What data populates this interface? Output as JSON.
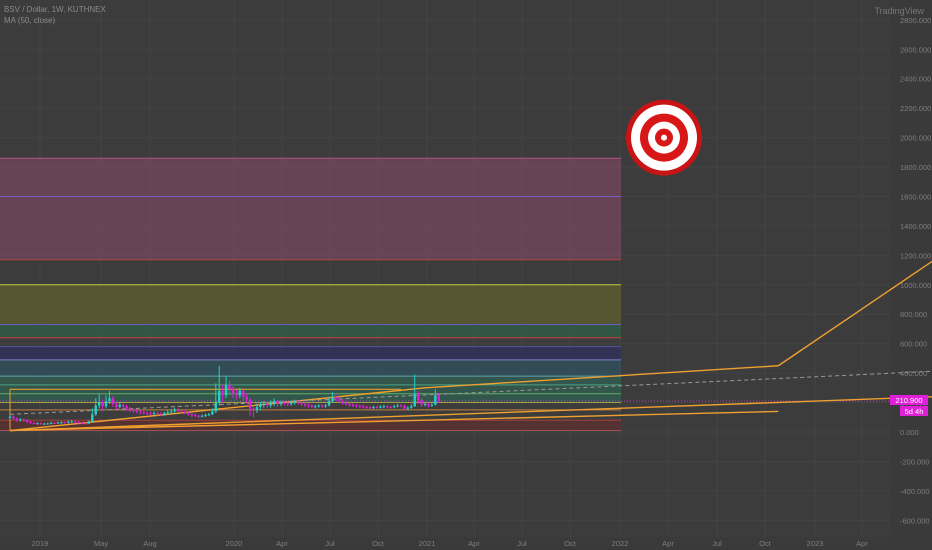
{
  "header": {
    "symbol_line": "BSV / Dollar, 1W, KUTHNEX",
    "indicator_line": "MA (50, close)"
  },
  "logo": "TradingView",
  "chart_data": {
    "type": "candlestick",
    "y_axis": {
      "ticks": [
        2800,
        2600,
        2400,
        2200,
        2000,
        1800,
        1600,
        1400,
        1200,
        1000,
        800,
        600,
        400,
        200,
        0,
        -200,
        -400,
        -600
      ],
      "tick_labels": [
        "2800.000",
        "2600.000",
        "2400.000",
        "2200.000",
        "2000.000",
        "1800.000",
        "1600.000",
        "1400.000",
        "1200.000",
        "1000.000",
        "800.000",
        "600.000",
        "400.000",
        "200.000",
        "0.000",
        "-200.000",
        "-400.000",
        "-600.000"
      ]
    },
    "x_axis": {
      "labels": [
        "2019",
        "May",
        "Aug",
        "2020",
        "Apr",
        "Jul",
        "Oct",
        "2021",
        "Apr",
        "Jul",
        "Oct",
        "2022",
        "Apr",
        "Jul",
        "Oct",
        "2023",
        "Apr"
      ]
    },
    "price_label": "210.900",
    "countdown_label": "5d 4h",
    "target_price": 2000,
    "fib_levels": [
      {
        "price": 1860,
        "color": "#b0508a"
      },
      {
        "price": 1600,
        "color": "#7a5cc0"
      },
      {
        "price": 1170,
        "color": "#b04040"
      },
      {
        "price": 1000,
        "color": "#c8c840"
      },
      {
        "price": 730,
        "color": "#6060c0"
      },
      {
        "price": 640,
        "color": "#c84040"
      },
      {
        "price": 580,
        "color": "#5050a0"
      },
      {
        "price": 490,
        "color": "#8080d0"
      },
      {
        "price": 380,
        "color": "#60a0b0"
      },
      {
        "price": 320,
        "color": "#50a080"
      },
      {
        "price": 260,
        "color": "#60b060"
      },
      {
        "price": 200,
        "color": "#a0a040"
      },
      {
        "price": 150,
        "color": "#c08040"
      },
      {
        "price": 80,
        "color": "#a04040"
      },
      {
        "price": 10,
        "color": "#a05050"
      }
    ],
    "fib_zones": [
      {
        "from": 1170,
        "to": 1860,
        "color": "#8a4a6a"
      },
      {
        "from": 730,
        "to": 1000,
        "color": "#6a6a2a"
      },
      {
        "from": 640,
        "to": 730,
        "color": "#2a6a4a"
      },
      {
        "from": 490,
        "to": 580,
        "color": "#2a2a6a"
      },
      {
        "from": 380,
        "to": 490,
        "color": "#2a5a6a"
      },
      {
        "from": 200,
        "to": 380,
        "color": "#2a6a5a"
      },
      {
        "from": 10,
        "to": 80,
        "color": "#6a2a2a"
      }
    ],
    "candles": [
      {
        "o": 95,
        "c": 105,
        "h": 115,
        "l": 85
      },
      {
        "o": 105,
        "c": 90,
        "h": 112,
        "l": 82
      },
      {
        "o": 90,
        "c": 80,
        "h": 100,
        "l": 70
      },
      {
        "o": 80,
        "c": 85,
        "h": 95,
        "l": 72
      },
      {
        "o": 85,
        "c": 78,
        "h": 92,
        "l": 70
      },
      {
        "o": 78,
        "c": 68,
        "h": 85,
        "l": 60
      },
      {
        "o": 68,
        "c": 62,
        "h": 75,
        "l": 55
      },
      {
        "o": 62,
        "c": 58,
        "h": 68,
        "l": 52
      },
      {
        "o": 58,
        "c": 60,
        "h": 66,
        "l": 50
      },
      {
        "o": 60,
        "c": 55,
        "h": 65,
        "l": 48
      },
      {
        "o": 55,
        "c": 56,
        "h": 62,
        "l": 50
      },
      {
        "o": 56,
        "c": 58,
        "h": 64,
        "l": 50
      },
      {
        "o": 58,
        "c": 62,
        "h": 70,
        "l": 52
      },
      {
        "o": 62,
        "c": 60,
        "h": 68,
        "l": 54
      },
      {
        "o": 60,
        "c": 64,
        "h": 72,
        "l": 56
      },
      {
        "o": 64,
        "c": 66,
        "h": 74,
        "l": 58
      },
      {
        "o": 66,
        "c": 62,
        "h": 72,
        "l": 56
      },
      {
        "o": 62,
        "c": 70,
        "h": 78,
        "l": 58
      },
      {
        "o": 70,
        "c": 72,
        "h": 82,
        "l": 62
      },
      {
        "o": 72,
        "c": 68,
        "h": 80,
        "l": 60
      },
      {
        "o": 68,
        "c": 62,
        "h": 74,
        "l": 55
      },
      {
        "o": 62,
        "c": 60,
        "h": 68,
        "l": 52
      },
      {
        "o": 60,
        "c": 58,
        "h": 66,
        "l": 50
      },
      {
        "o": 58,
        "c": 70,
        "h": 78,
        "l": 54
      },
      {
        "o": 70,
        "c": 120,
        "h": 160,
        "l": 65
      },
      {
        "o": 120,
        "c": 180,
        "h": 230,
        "l": 110
      },
      {
        "o": 180,
        "c": 200,
        "h": 260,
        "l": 160
      },
      {
        "o": 200,
        "c": 175,
        "h": 220,
        "l": 150
      },
      {
        "o": 175,
        "c": 210,
        "h": 250,
        "l": 160
      },
      {
        "o": 210,
        "c": 230,
        "h": 280,
        "l": 190
      },
      {
        "o": 230,
        "c": 190,
        "h": 245,
        "l": 170
      },
      {
        "o": 190,
        "c": 170,
        "h": 205,
        "l": 150
      },
      {
        "o": 170,
        "c": 185,
        "h": 200,
        "l": 160
      },
      {
        "o": 185,
        "c": 175,
        "h": 195,
        "l": 160
      },
      {
        "o": 175,
        "c": 160,
        "h": 185,
        "l": 145
      },
      {
        "o": 160,
        "c": 150,
        "h": 170,
        "l": 135
      },
      {
        "o": 150,
        "c": 145,
        "h": 160,
        "l": 130
      },
      {
        "o": 145,
        "c": 140,
        "h": 155,
        "l": 125
      },
      {
        "o": 140,
        "c": 135,
        "h": 150,
        "l": 120
      },
      {
        "o": 135,
        "c": 130,
        "h": 145,
        "l": 118
      },
      {
        "o": 130,
        "c": 128,
        "h": 140,
        "l": 115
      },
      {
        "o": 128,
        "c": 125,
        "h": 138,
        "l": 112
      },
      {
        "o": 125,
        "c": 130,
        "h": 140,
        "l": 115
      },
      {
        "o": 130,
        "c": 125,
        "h": 138,
        "l": 112
      },
      {
        "o": 125,
        "c": 120,
        "h": 135,
        "l": 108
      },
      {
        "o": 120,
        "c": 128,
        "h": 138,
        "l": 110
      },
      {
        "o": 128,
        "c": 135,
        "h": 150,
        "l": 120
      },
      {
        "o": 135,
        "c": 140,
        "h": 155,
        "l": 125
      },
      {
        "o": 140,
        "c": 150,
        "h": 165,
        "l": 130
      },
      {
        "o": 150,
        "c": 145,
        "h": 160,
        "l": 135
      },
      {
        "o": 145,
        "c": 138,
        "h": 150,
        "l": 125
      },
      {
        "o": 138,
        "c": 130,
        "h": 145,
        "l": 120
      },
      {
        "o": 130,
        "c": 120,
        "h": 140,
        "l": 110
      },
      {
        "o": 120,
        "c": 115,
        "h": 130,
        "l": 100
      },
      {
        "o": 115,
        "c": 110,
        "h": 125,
        "l": 100
      },
      {
        "o": 110,
        "c": 108,
        "h": 118,
        "l": 98
      },
      {
        "o": 108,
        "c": 110,
        "h": 120,
        "l": 100
      },
      {
        "o": 110,
        "c": 115,
        "h": 125,
        "l": 102
      },
      {
        "o": 115,
        "c": 120,
        "h": 130,
        "l": 108
      },
      {
        "o": 120,
        "c": 140,
        "h": 160,
        "l": 115
      },
      {
        "o": 140,
        "c": 200,
        "h": 330,
        "l": 130
      },
      {
        "o": 200,
        "c": 280,
        "h": 450,
        "l": 180
      },
      {
        "o": 280,
        "c": 250,
        "h": 320,
        "l": 200
      },
      {
        "o": 250,
        "c": 320,
        "h": 380,
        "l": 230
      },
      {
        "o": 320,
        "c": 290,
        "h": 350,
        "l": 250
      },
      {
        "o": 290,
        "c": 260,
        "h": 310,
        "l": 230
      },
      {
        "o": 260,
        "c": 250,
        "h": 285,
        "l": 220
      },
      {
        "o": 250,
        "c": 280,
        "h": 300,
        "l": 230
      },
      {
        "o": 280,
        "c": 240,
        "h": 290,
        "l": 210
      },
      {
        "o": 240,
        "c": 220,
        "h": 260,
        "l": 190
      },
      {
        "o": 220,
        "c": 160,
        "h": 230,
        "l": 110
      },
      {
        "o": 160,
        "c": 150,
        "h": 180,
        "l": 100
      },
      {
        "o": 150,
        "c": 170,
        "h": 190,
        "l": 130
      },
      {
        "o": 170,
        "c": 185,
        "h": 205,
        "l": 150
      },
      {
        "o": 185,
        "c": 190,
        "h": 210,
        "l": 165
      },
      {
        "o": 190,
        "c": 180,
        "h": 205,
        "l": 160
      },
      {
        "o": 180,
        "c": 195,
        "h": 215,
        "l": 165
      },
      {
        "o": 195,
        "c": 210,
        "h": 230,
        "l": 175
      },
      {
        "o": 210,
        "c": 190,
        "h": 220,
        "l": 170
      },
      {
        "o": 190,
        "c": 200,
        "h": 215,
        "l": 175
      },
      {
        "o": 200,
        "c": 195,
        "h": 210,
        "l": 180
      },
      {
        "o": 195,
        "c": 190,
        "h": 205,
        "l": 175
      },
      {
        "o": 190,
        "c": 200,
        "h": 215,
        "l": 178
      },
      {
        "o": 200,
        "c": 205,
        "h": 220,
        "l": 185
      },
      {
        "o": 205,
        "c": 200,
        "h": 215,
        "l": 185
      },
      {
        "o": 200,
        "c": 190,
        "h": 210,
        "l": 175
      },
      {
        "o": 190,
        "c": 185,
        "h": 200,
        "l": 170
      },
      {
        "o": 185,
        "c": 180,
        "h": 195,
        "l": 165
      },
      {
        "o": 180,
        "c": 170,
        "h": 190,
        "l": 160
      },
      {
        "o": 170,
        "c": 175,
        "h": 185,
        "l": 160
      },
      {
        "o": 175,
        "c": 180,
        "h": 190,
        "l": 165
      },
      {
        "o": 180,
        "c": 175,
        "h": 190,
        "l": 165
      },
      {
        "o": 175,
        "c": 180,
        "h": 190,
        "l": 165
      },
      {
        "o": 180,
        "c": 210,
        "h": 240,
        "l": 175
      },
      {
        "o": 210,
        "c": 240,
        "h": 270,
        "l": 200
      },
      {
        "o": 240,
        "c": 225,
        "h": 260,
        "l": 210
      },
      {
        "o": 225,
        "c": 210,
        "h": 240,
        "l": 195
      },
      {
        "o": 210,
        "c": 200,
        "h": 225,
        "l": 185
      },
      {
        "o": 200,
        "c": 190,
        "h": 210,
        "l": 178
      },
      {
        "o": 190,
        "c": 185,
        "h": 200,
        "l": 172
      },
      {
        "o": 185,
        "c": 180,
        "h": 195,
        "l": 168
      },
      {
        "o": 180,
        "c": 178,
        "h": 190,
        "l": 165
      },
      {
        "o": 178,
        "c": 175,
        "h": 188,
        "l": 162
      },
      {
        "o": 175,
        "c": 170,
        "h": 185,
        "l": 160
      },
      {
        "o": 170,
        "c": 168,
        "h": 180,
        "l": 158
      },
      {
        "o": 168,
        "c": 165,
        "h": 178,
        "l": 155
      },
      {
        "o": 165,
        "c": 170,
        "h": 180,
        "l": 155
      },
      {
        "o": 170,
        "c": 168,
        "h": 178,
        "l": 158
      },
      {
        "o": 168,
        "c": 172,
        "h": 182,
        "l": 160
      },
      {
        "o": 172,
        "c": 175,
        "h": 185,
        "l": 162
      },
      {
        "o": 175,
        "c": 170,
        "h": 182,
        "l": 160
      },
      {
        "o": 170,
        "c": 168,
        "h": 178,
        "l": 158
      },
      {
        "o": 168,
        "c": 175,
        "h": 185,
        "l": 160
      },
      {
        "o": 175,
        "c": 180,
        "h": 192,
        "l": 168
      },
      {
        "o": 180,
        "c": 178,
        "h": 190,
        "l": 168
      },
      {
        "o": 178,
        "c": 160,
        "h": 185,
        "l": 150
      },
      {
        "o": 160,
        "c": 165,
        "h": 175,
        "l": 150
      },
      {
        "o": 165,
        "c": 175,
        "h": 190,
        "l": 158
      },
      {
        "o": 175,
        "c": 260,
        "h": 390,
        "l": 170
      },
      {
        "o": 260,
        "c": 215,
        "h": 280,
        "l": 190
      },
      {
        "o": 215,
        "c": 185,
        "h": 230,
        "l": 170
      },
      {
        "o": 185,
        "c": 190,
        "h": 205,
        "l": 175
      },
      {
        "o": 190,
        "c": 180,
        "h": 200,
        "l": 168
      },
      {
        "o": 180,
        "c": 185,
        "h": 200,
        "l": 170
      },
      {
        "o": 185,
        "c": 250,
        "h": 290,
        "l": 180
      },
      {
        "o": 250,
        "c": 210,
        "h": 265,
        "l": 195
      }
    ],
    "channel_top": {
      "x": [
        0.0,
        114.0
      ],
      "y": [
        290.0,
        290.0
      ]
    },
    "trend_lines": [
      {
        "x": [
          0.0,
          121.0
        ],
        "y": [
          10.0,
          300.0
        ]
      },
      {
        "x": [
          121.0,
          224.0
        ],
        "y": [
          300.0,
          450.0
        ]
      },
      {
        "x": [
          0.0,
          224.0
        ],
        "y": [
          10.0,
          140.0
        ]
      },
      {
        "x": [
          0.0,
          270.0
        ],
        "y": [
          10.0,
          240.0
        ]
      },
      {
        "x": [
          224.0,
          322.0
        ],
        "y": [
          450.0,
          2000.0
        ]
      }
    ],
    "projection": {
      "x": [
        0.0,
        322.0
      ],
      "y": [
        120.0,
        470.0
      ]
    }
  }
}
